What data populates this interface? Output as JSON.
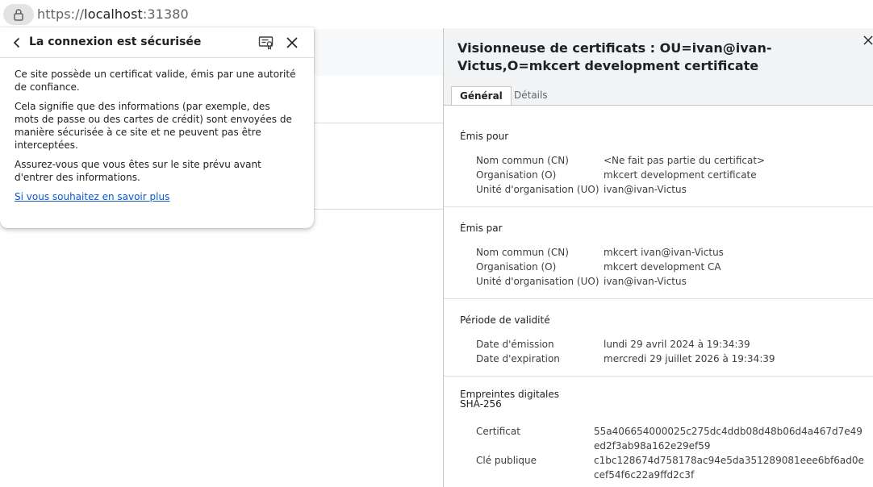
{
  "address_bar": {
    "scheme": "https://",
    "host": "localhost",
    "port": ":31380"
  },
  "popup": {
    "title": "La connexion est sécurisée",
    "paragraphs": [
      "Ce site possède un certificat valide, émis par une autorité de confiance.",
      "Cela signifie que des informations (par exemple, des mots de passe ou des cartes de crédit) sont envoyées de manière sécurisée à ce site et ne peuvent pas être interceptées.",
      "Assurez-vous que vous êtes sur le site prévu avant d'entrer des informations."
    ],
    "learn_more": "Si vous souhaitez en savoir plus"
  },
  "viewer": {
    "title": "Visionneuse de certificats : OU=ivan@ivan-Victus,O=mkcert development certificate",
    "tabs": [
      "Général",
      "Détails"
    ],
    "sections": {
      "issued_to": {
        "title": "Émis pour",
        "rows": [
          {
            "label": "Nom commun (CN)",
            "value": "<Ne fait pas partie du certificat>"
          },
          {
            "label": "Organisation (O)",
            "value": "mkcert development certificate"
          },
          {
            "label": "Unité d'organisation (UO)",
            "value": "ivan@ivan-Victus"
          }
        ]
      },
      "issued_by": {
        "title": "Émis par",
        "rows": [
          {
            "label": "Nom commun (CN)",
            "value": "mkcert ivan@ivan-Victus"
          },
          {
            "label": "Organisation (O)",
            "value": "mkcert development CA"
          },
          {
            "label": "Unité d'organisation (UO)",
            "value": "ivan@ivan-Victus"
          }
        ]
      },
      "validity": {
        "title": "Période de validité",
        "rows": [
          {
            "label": "Date d'émission",
            "value": "lundi 29 avril 2024 à 19:34:39"
          },
          {
            "label": "Date d'expiration",
            "value": "mercredi 29 juillet 2026 à 19:34:39"
          }
        ]
      },
      "fingerprints": {
        "title": "Empreintes digitales SHA-256",
        "rows": [
          {
            "label": "Certificat",
            "value": "55a406654000025c275dc4ddb08d48b06d4a467d7e49ed2f3ab98a162e29ef59"
          },
          {
            "label": "Clé publique",
            "value": "c1bc128674d758178ac94e5da351289081eee6bf6ad0ecef54f6c22a9ffd2c3f"
          }
        ]
      }
    }
  }
}
